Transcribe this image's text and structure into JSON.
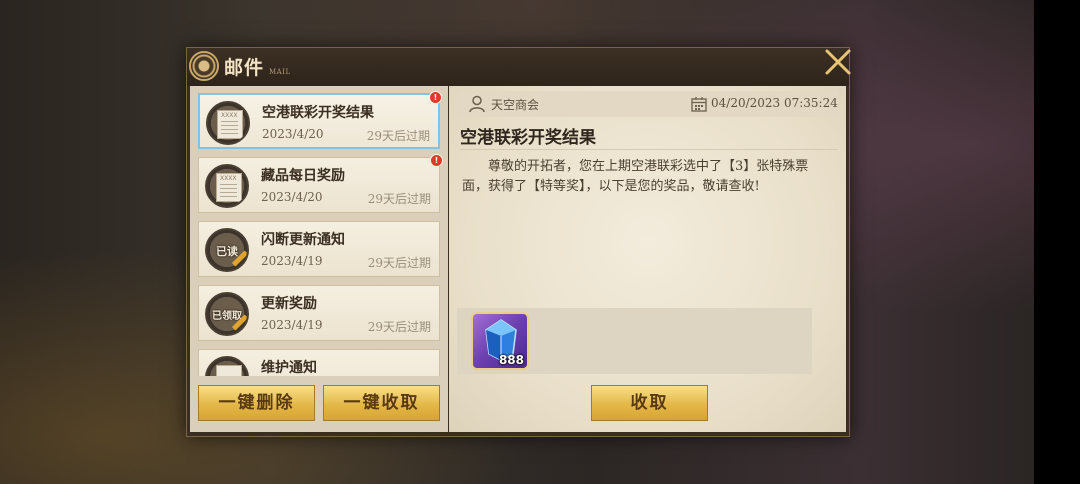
{
  "dialog": {
    "title": "邮件",
    "subtitle": "MAIL"
  },
  "mail_list": [
    {
      "title": "空港联彩开奖结果",
      "date": "2023/4/20",
      "expire": "29天后过期",
      "status": "unread",
      "selected": true,
      "stamp": ""
    },
    {
      "title": "藏品每日奖励",
      "date": "2023/4/20",
      "expire": "29天后过期",
      "status": "unread",
      "selected": false,
      "stamp": ""
    },
    {
      "title": "闪断更新通知",
      "date": "2023/4/19",
      "expire": "29天后过期",
      "status": "read",
      "selected": false,
      "stamp": "已读"
    },
    {
      "title": "更新奖励",
      "date": "2023/4/19",
      "expire": "29天后过期",
      "status": "claimed",
      "selected": false,
      "stamp": "已领取"
    },
    {
      "title": "维护通知",
      "date": "",
      "expire": "",
      "status": "read",
      "selected": false,
      "stamp": ""
    }
  ],
  "unread_badge": "!",
  "buttons": {
    "delete_all": "一键删除",
    "claim_all": "一键收取",
    "claim": "收取"
  },
  "detail": {
    "sender": "天空商会",
    "time": "04/20/2023 07:35:24",
    "title": "空港联彩开奖结果",
    "body": "尊敬的开拓者，您在上期空港联彩选中了【3】张特殊票面，获得了【特等奖】，以下是您的奖品，敬请查收!",
    "reward": {
      "icon": "blue-crystal-icon",
      "count": "888"
    }
  },
  "colors": {
    "frame": "#3a2e22",
    "gold_button": "#e4b848",
    "selected_border": "#7fc4e6",
    "unread_dot": "#e23a2a"
  }
}
